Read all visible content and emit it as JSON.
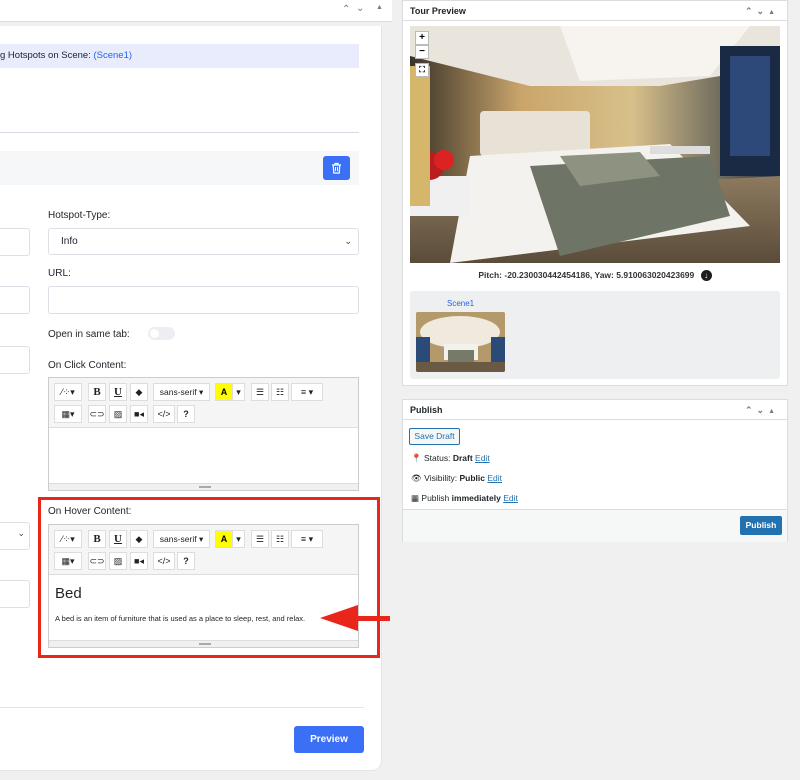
{
  "left": {
    "banner_prefix": "g Hotspots on Scene:",
    "banner_scene": "(Scene1)",
    "hotspot_type_label": "Hotspot-Type:",
    "hotspot_type_value": "Info",
    "url_label": "URL:",
    "url_value": "",
    "open_same_tab_label": "Open in same tab:",
    "open_same_tab_on": false,
    "on_click_label": "On Click Content:",
    "on_hover_label": "On Hover Content:",
    "toolbar": {
      "font_family": "sans-serif",
      "bold": "B",
      "underline": "U",
      "code": "</>",
      "help": "?"
    },
    "hover_content": {
      "heading": "Bed",
      "body": "A bed is an item of furniture that is used as a place to sleep, rest, and relax."
    },
    "preview_label": "Preview"
  },
  "tour_preview": {
    "title": "Tour Preview",
    "zoom_in": "+",
    "zoom_out": "−",
    "pitch_label": "Pitch:",
    "pitch_value": "-20.230030442454186",
    "yaw_label": "Yaw:",
    "yaw_value": "5.910063020423699",
    "scene_name": "Scene1"
  },
  "publish": {
    "title": "Publish",
    "save_draft": "Save Draft",
    "status_label": "Status:",
    "status_value": "Draft",
    "visibility_label": "Visibility:",
    "visibility_value": "Public",
    "publish_label": "Publish",
    "publish_when": "immediately",
    "edit": "Edit",
    "publish_button": "Publish"
  },
  "colors": {
    "accent": "#3b6ff5",
    "wp_blue": "#2271b1",
    "highlight_red": "#e8261a"
  }
}
